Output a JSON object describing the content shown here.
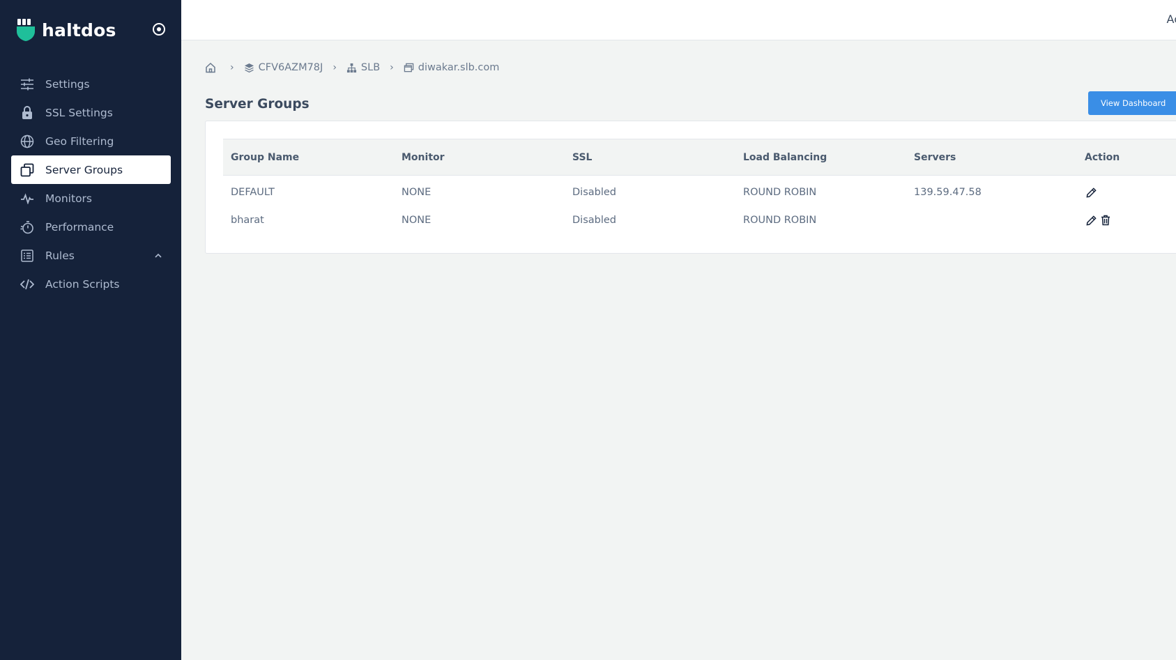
{
  "brand": {
    "name": "haltdos",
    "accent": "#1fbf9a"
  },
  "sidebar": {
    "items": [
      {
        "label": "Settings",
        "icon": "sliders-icon"
      },
      {
        "label": "SSL Settings",
        "icon": "lock-icon"
      },
      {
        "label": "Geo Filtering",
        "icon": "globe-icon"
      },
      {
        "label": "Server Groups",
        "icon": "server-groups-icon",
        "active": true
      },
      {
        "label": "Monitors",
        "icon": "pulse-icon"
      },
      {
        "label": "Performance",
        "icon": "stopwatch-icon"
      },
      {
        "label": "Rules",
        "icon": "list-icon",
        "expandable": true
      },
      {
        "label": "Action Scripts",
        "icon": "code-icon"
      }
    ]
  },
  "topbar": {
    "user_label": "Ac"
  },
  "breadcrumb": {
    "items": [
      {
        "label": "CFV6AZM78J",
        "icon": "layers-icon"
      },
      {
        "label": "SLB",
        "icon": "sitemap-icon"
      },
      {
        "label": "diwakar.slb.com",
        "icon": "window-icon"
      }
    ]
  },
  "page": {
    "title": "Server Groups",
    "view_dashboard_label": "View Dashboard"
  },
  "table": {
    "headers": [
      "Group Name",
      "Monitor",
      "SSL",
      "Load Balancing",
      "Servers",
      "Action"
    ],
    "rows": [
      {
        "group_name": "DEFAULT",
        "monitor": "NONE",
        "ssl": "Disabled",
        "load_balancing": "ROUND ROBIN",
        "servers": "139.59.47.58",
        "deletable": false
      },
      {
        "group_name": "bharat",
        "monitor": "NONE",
        "ssl": "Disabled",
        "load_balancing": "ROUND ROBIN",
        "servers": "",
        "deletable": true
      }
    ]
  },
  "colors": {
    "sidebar_bg": "#15223a",
    "link": "#3a8ee6",
    "button": "#3a8ee6"
  }
}
